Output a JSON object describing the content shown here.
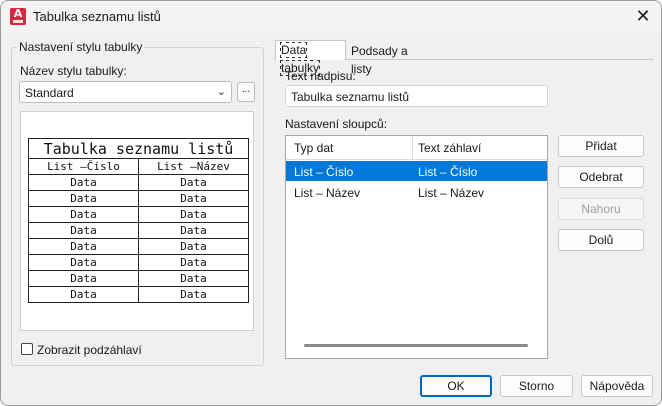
{
  "window": {
    "title": "Tabulka seznamu listů",
    "close_glyph": "✕",
    "app_icon_letter": "A"
  },
  "left": {
    "group_title": "Nastavení stylu tabulky",
    "style_name_label": "Název stylu tabulky:",
    "style_name_value": "Standard",
    "browse_label": "...",
    "preview": {
      "title": "Tabulka seznamu listů",
      "headers": [
        "List –Číslo",
        "List –Název"
      ],
      "rows": [
        [
          "Data",
          "Data"
        ],
        [
          "Data",
          "Data"
        ],
        [
          "Data",
          "Data"
        ],
        [
          "Data",
          "Data"
        ],
        [
          "Data",
          "Data"
        ],
        [
          "Data",
          "Data"
        ],
        [
          "Data",
          "Data"
        ],
        [
          "Data",
          "Data"
        ]
      ]
    },
    "show_subheader_label": "Zobrazit podzáhlaví",
    "show_subheader_checked": false
  },
  "tabs": [
    {
      "label": "Data tabulky",
      "active": true
    },
    {
      "label": "Podsady a listy",
      "active": false
    }
  ],
  "data_tab": {
    "caption_label": "Text nadpisu:",
    "caption_value": "Tabulka seznamu listů",
    "columns_label": "Nastavení sloupců:",
    "columns_headers": [
      "Typ dat",
      "Text záhlaví"
    ],
    "columns_rows": [
      {
        "type": "List – Číslo",
        "header": "List – Číslo",
        "selected": true
      },
      {
        "type": "List – Název",
        "header": "List – Název",
        "selected": false
      }
    ],
    "buttons": {
      "add": "Přidat",
      "remove": "Odebrat",
      "up": "Nahoru",
      "down": "Dolů"
    }
  },
  "footer": {
    "ok": "OK",
    "cancel": "Storno",
    "help": "Nápověda"
  },
  "colors": {
    "selection": "#0078d7",
    "accent": "#0067c0",
    "app_icon": "#d7263d"
  }
}
